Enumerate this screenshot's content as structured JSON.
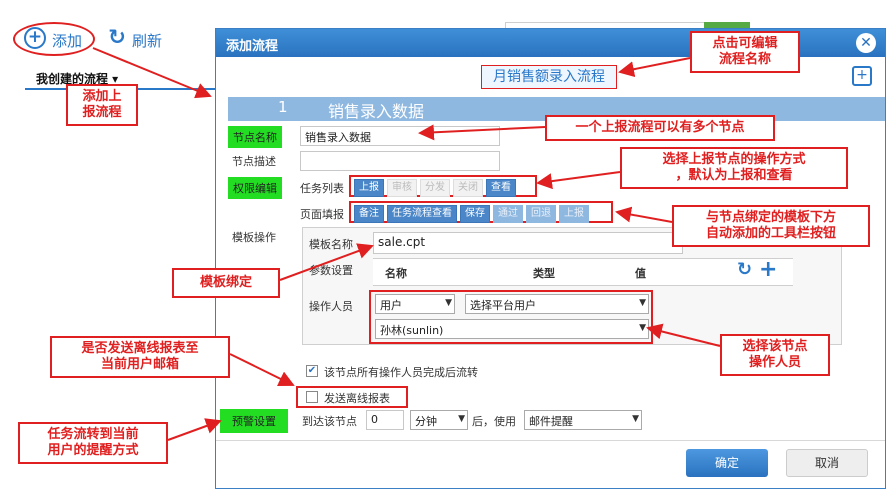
{
  "background": {
    "add_label": "添加",
    "refresh_label": "刷新",
    "tab_label": "我创建的流程 ▾"
  },
  "dialog": {
    "title": "添加流程",
    "flow_name": "月销售额录入流程",
    "node_number": "1",
    "node_title": "销售录入数据",
    "node_name_label": "节点名称",
    "node_name_value": "销售录入数据",
    "node_desc_label": "节点描述",
    "node_desc_value": "",
    "permission_label": "权限编辑",
    "task_list_label": "任务列表",
    "task_list_buttons": [
      "上报",
      "审核",
      "分发",
      "关闭",
      "查看"
    ],
    "page_fill_label": "页面填报",
    "page_fill_buttons": [
      "备注",
      "任务流程查看",
      "保存",
      "通过",
      "回退",
      "上报"
    ],
    "template_op_label": "模板操作",
    "template_name_label": "模板名称",
    "template_name_value": "sale.cpt",
    "param_label": "参数设置",
    "param_columns": [
      "名称",
      "类型",
      "值"
    ],
    "operator_label": "操作人员",
    "operator_type": "用户",
    "operator_source": "选择平台用户",
    "operator_user": "孙林(sunlin)",
    "flow_check_label": "该节点所有操作人员完成后流转",
    "offline_label": "发送离线报表",
    "warn_label": "预警设置",
    "arrive_label": "到达该节点",
    "arrive_value": "0",
    "unit_value": "分钟",
    "after_use_label": "后，使用",
    "remind_value": "邮件提醒",
    "ok_label": "确定",
    "cancel_label": "取消"
  },
  "annotations": {
    "add_flow": "添加上\n报流程",
    "edit_name": "点击可编辑\n流程名称",
    "multi_nodes": "一个上报流程可以有多个节点",
    "op_mode": "选择上报节点的操作方式\n，默认为上报和查看",
    "toolbar": "与节点绑定的模板下方\n自动添加的工具栏按钮",
    "template_bind": "模板绑定",
    "offline_mail": "是否发送离线报表至\n当前用户邮箱",
    "operator": "选择该节点\n操作人员",
    "reminder": "任务流转到当前\n用户的提醒方式"
  },
  "colors": {
    "accent": "#2a78c8",
    "annotation": "#e02020",
    "label_green": "#22dd22",
    "node_bar": "#8fb8e0"
  }
}
